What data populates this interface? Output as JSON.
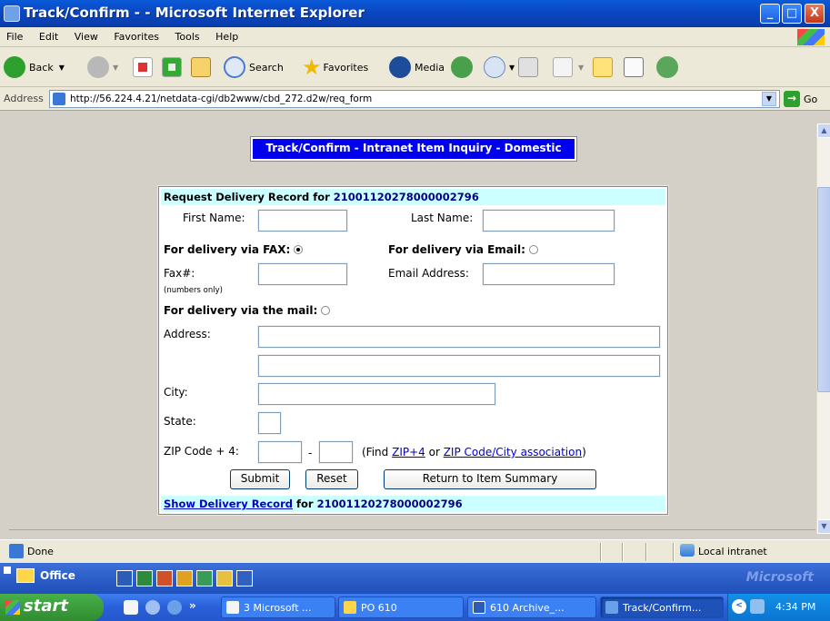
{
  "window": {
    "title": "Track/Confirm - - Microsoft Internet Explorer",
    "min": "_",
    "max": "□",
    "close": "X"
  },
  "menu": [
    "File",
    "Edit",
    "View",
    "Favorites",
    "Tools",
    "Help"
  ],
  "toolbar": {
    "back": "Back",
    "search": "Search",
    "favorites": "Favorites",
    "media": "Media"
  },
  "address": {
    "label": "Address",
    "url": "http://56.224.4.21/netdata-cgi/db2www/cbd_272.d2w/req_form",
    "go": "Go"
  },
  "page": {
    "heading": "Track/Confirm - Intranet Item Inquiry - Domestic",
    "request_prefix": "Request Delivery Record for ",
    "item_number": "21001120278000002796",
    "first_name_label": "First Name:",
    "last_name_label": "Last Name:",
    "fax_option": "For delivery via FAX:",
    "email_option": "For delivery via Email:",
    "fax_label": "Fax#:",
    "fax_note": "(numbers only)",
    "email_label": "Email Address:",
    "mail_option": "For delivery via the mail:",
    "address_label": "Address:",
    "city_label": "City:",
    "state_label": "State:",
    "zip_label": "ZIP Code + 4:",
    "zip_dash": "-",
    "find_prefix": "(Find ",
    "zip4_link": "ZIP+4",
    "or_text": " or ",
    "zipcity_link": "ZIP Code/City association",
    "find_suffix": ")",
    "submit": "Submit",
    "reset": "Reset",
    "return": "Return to Item Summary",
    "show_link": "Show Delivery Record",
    "show_for": " for ",
    "delivery_method_selected": "fax"
  },
  "status": {
    "text": "Done",
    "zone": "Local intranet"
  },
  "officebar": {
    "label": "Office",
    "brand": "Microsoft"
  },
  "taskbar": {
    "start": "start",
    "tasks": [
      "3 Microsoft ...",
      "PO 610",
      "610 Archive_...",
      "Track/Confirm..."
    ],
    "clock": "4:34 PM",
    "chevron": "»"
  }
}
